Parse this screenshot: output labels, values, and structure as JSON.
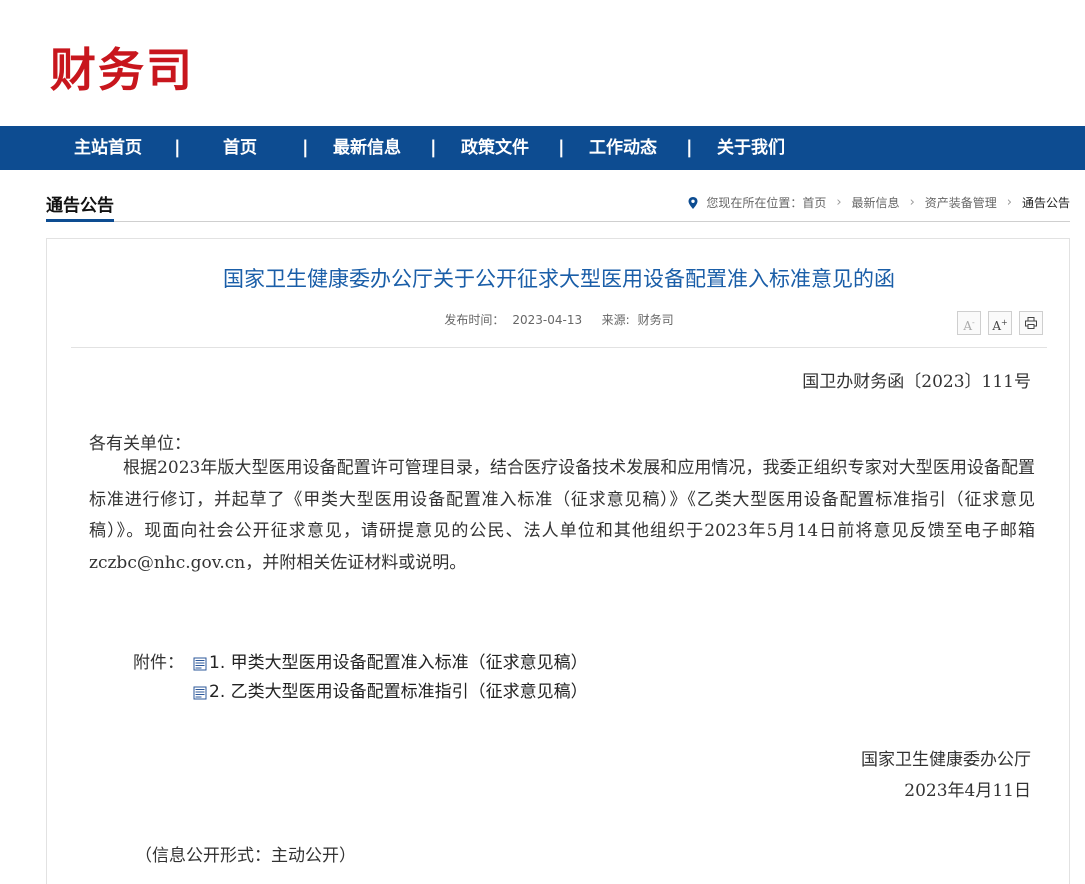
{
  "header": {
    "logo_text": "财务司"
  },
  "nav": {
    "items": [
      {
        "label": "主站首页"
      },
      {
        "label": "首页"
      },
      {
        "label": "最新信息"
      },
      {
        "label": "政策文件"
      },
      {
        "label": "工作动态"
      },
      {
        "label": "关于我们"
      }
    ],
    "separator": "|"
  },
  "section": {
    "title": "通告公告"
  },
  "breadcrumb": {
    "prefix": "您现在所在位置：",
    "items": [
      "首页",
      "最新信息",
      "资产装备管理",
      "通告公告"
    ],
    "arrow": "›"
  },
  "article": {
    "title": "国家卫生健康委办公厅关于公开征求大型医用设备配置准入标准意见的函",
    "publish_label": "发布时间：",
    "publish_date": "2023-04-13",
    "source_label": "来源:",
    "source": "财务司",
    "doc_number": "国卫办财务函〔2023〕111号",
    "salutation": "各有关单位：",
    "body": "根据2023年版大型医用设备配置许可管理目录，结合医疗设备技术发展和应用情况，我委正组织专家对大型医用设备配置标准进行修订，并起草了《甲类大型医用设备配置准入标准（征求意见稿）》《乙类大型医用设备配置标准指引（征求意见稿）》。现面向社会公开征求意见，请研提意见的公民、法人单位和其他组织于2023年5月14日前将意见反馈至电子邮箱zczbc@nhc.gov.cn，并附相关佐证材料或说明。",
    "attachment_label": "附件：",
    "attachments": [
      "1. 甲类大型医用设备配置准入标准（征求意见稿）",
      "2. 乙类大型医用设备配置标准指引（征求意见稿）"
    ],
    "signer": "国家卫生健康委办公厅",
    "sign_date": "2023年4月11日",
    "disclosure": "（信息公开形式：主动公开）"
  },
  "tools": {
    "font_smaller": "A",
    "font_larger": "A"
  },
  "colors": {
    "brand_red": "#c8161d",
    "nav_blue": "#0d4c91",
    "title_blue": "#1a5ea8"
  }
}
